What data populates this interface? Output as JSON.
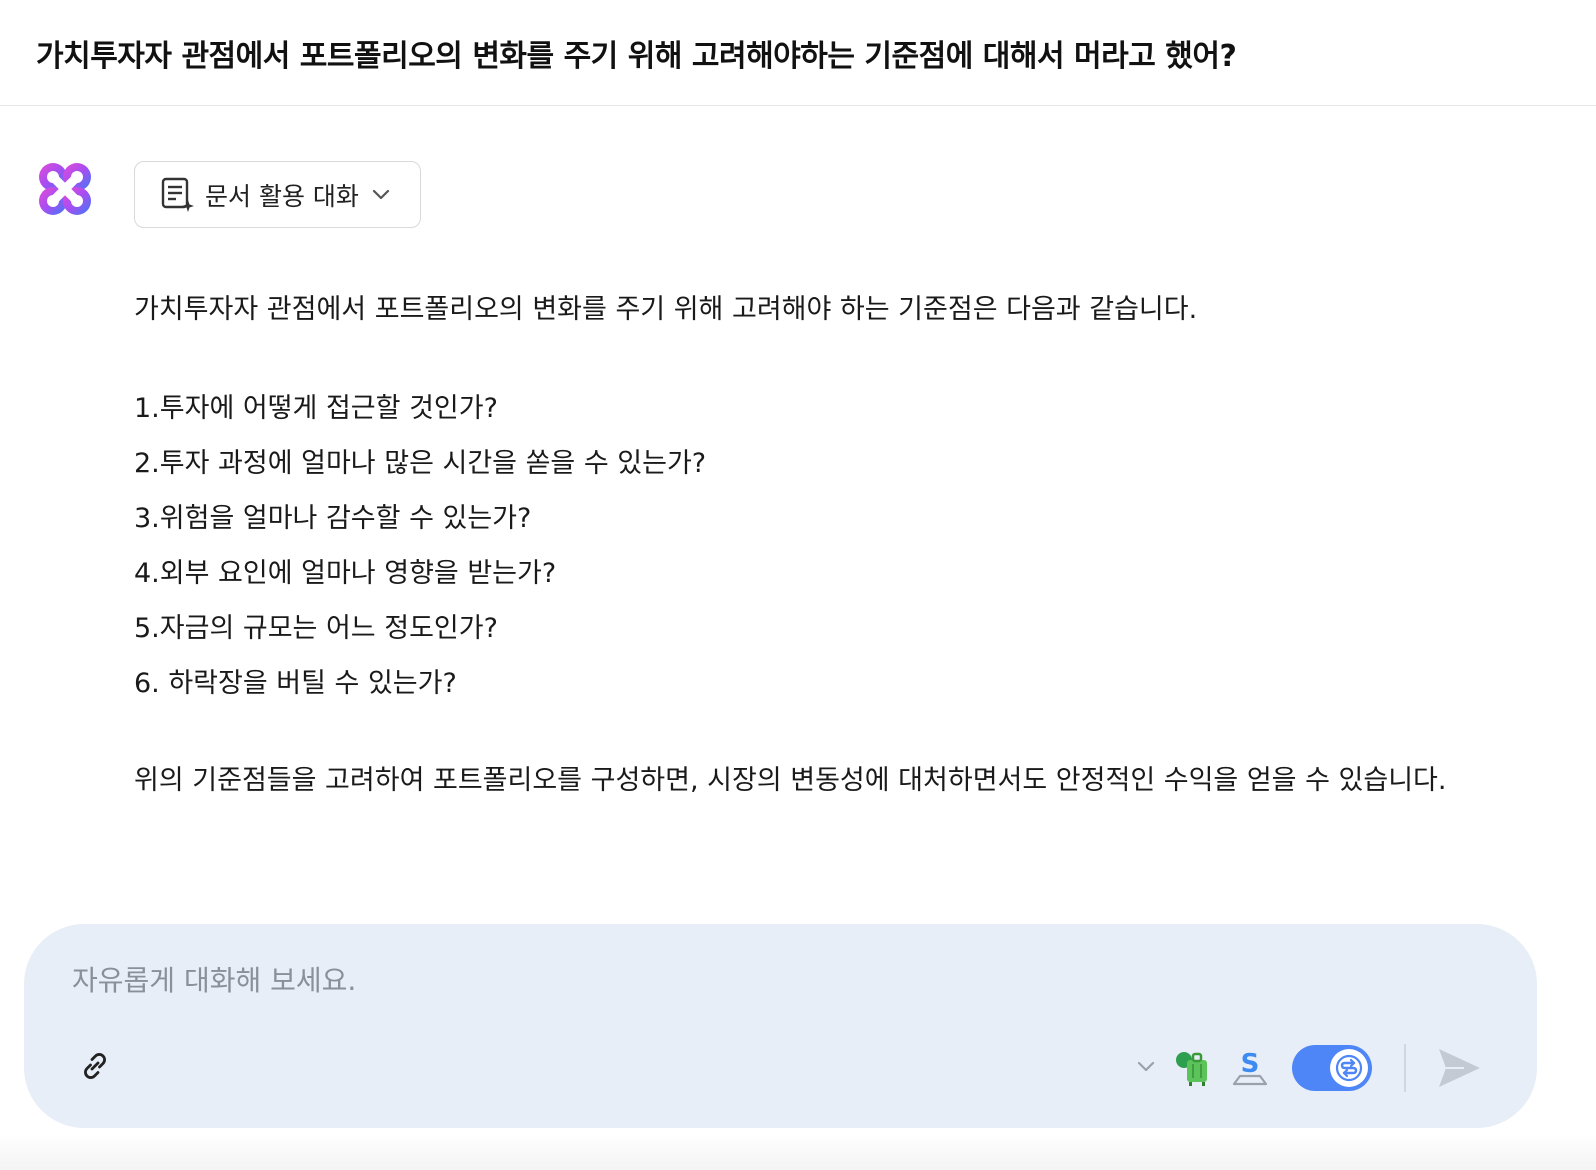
{
  "header": {
    "title": "가치투자자 관점에서 포트폴리오의 변화를 주기 위해 고려해야하는 기준점에 대해서 머라고 했어?"
  },
  "assistant": {
    "logo_icon": "multicolor-clover-logo-icon",
    "mode_button": {
      "icon": "document-sparkle-icon",
      "label": "문서 활용 대화",
      "chevron": "chevron-down-icon"
    },
    "answer": {
      "intro": "가치투자자 관점에서 포트폴리오의 변화를 주기 위해 고려해야 하는 기준점은 다음과 같습니다.",
      "items": [
        "1.투자에 어떻게 접근할 것인가?",
        "2.투자 과정에 얼마나 많은 시간을 쏟을 수 있는가?",
        "3.위험을 얼마나 감수할 수 있는가?",
        "4.외부 요인에 얼마나 영향을 받는가?",
        "5.자금의 규모는 어느 정도인가?",
        "6. 하락장을 버틸 수 있는가?"
      ],
      "outro": "위의 기준점들을 고려하여 포트폴리오를 구성하면, 시장의 변동성에 대처하면서도 안정적인 수익을 얻을 수 있습니다."
    }
  },
  "composer": {
    "placeholder": "자유롭게 대화해 보세요.",
    "attach_icon": "link-icon",
    "tools_chevron": "chevron-down-icon",
    "tool_a_icon": "green-luggage-plugin-icon",
    "tool_s_icon": "blue-s-plugin-icon",
    "toggle": {
      "state": "on",
      "icon": "s-swap-icon",
      "color": "#4f86f7"
    },
    "send_icon": "send-icon",
    "background_color": "#e8eef7"
  }
}
